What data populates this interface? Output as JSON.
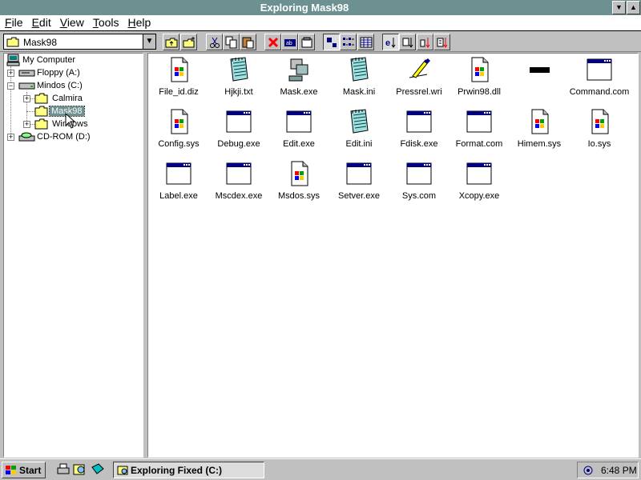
{
  "window": {
    "title": "Exploring Mask98"
  },
  "menu": [
    "File",
    "Edit",
    "View",
    "Tools",
    "Help"
  ],
  "toolbar": {
    "path_value": "Mask98",
    "dropdown_glyph": "▼"
  },
  "tree": {
    "my_computer": "My Computer",
    "floppy": "Floppy (A:)",
    "mindos": "Mindos (C:)",
    "calmira": "Calmira",
    "mask98": "Mask98",
    "windows": "Windows",
    "cdrom": "CD-ROM (D:)",
    "expander_plus": "+",
    "expander_minus": "−"
  },
  "files": [
    {
      "name": "File_id.diz",
      "icon": "windows-logo-doc"
    },
    {
      "name": "Hjkji.txt",
      "icon": "notepad"
    },
    {
      "name": "Mask.exe",
      "icon": "program-squares"
    },
    {
      "name": "Mask.ini",
      "icon": "notepad"
    },
    {
      "name": "Pressrel.wri",
      "icon": "write-pen"
    },
    {
      "name": "Prwin98.dll",
      "icon": "windows-logo-doc"
    },
    {
      "name": "",
      "icon": "black-bar"
    },
    {
      "name": "Command.com",
      "icon": "window-app"
    },
    {
      "name": "Config.sys",
      "icon": "windows-logo-doc"
    },
    {
      "name": "Debug.exe",
      "icon": "window-app"
    },
    {
      "name": "Edit.exe",
      "icon": "window-app"
    },
    {
      "name": "Edit.ini",
      "icon": "notepad"
    },
    {
      "name": "Fdisk.exe",
      "icon": "window-app"
    },
    {
      "name": "Format.com",
      "icon": "window-app"
    },
    {
      "name": "Himem.sys",
      "icon": "windows-logo-doc"
    },
    {
      "name": "Io.sys",
      "icon": "windows-logo-doc"
    },
    {
      "name": "Label.exe",
      "icon": "window-app"
    },
    {
      "name": "Mscdex.exe",
      "icon": "window-app"
    },
    {
      "name": "Msdos.sys",
      "icon": "windows-logo-doc"
    },
    {
      "name": "Setver.exe",
      "icon": "window-app"
    },
    {
      "name": "Sys.com",
      "icon": "window-app"
    },
    {
      "name": "Xcopy.exe",
      "icon": "window-app"
    }
  ],
  "taskbar": {
    "start": "Start",
    "task": "Exploring Fixed (C:)",
    "clock": "6:48 PM"
  },
  "colors": {
    "titlebar": "#6d9191",
    "selection": "#6d9191",
    "app_window_blue": "#000080"
  }
}
